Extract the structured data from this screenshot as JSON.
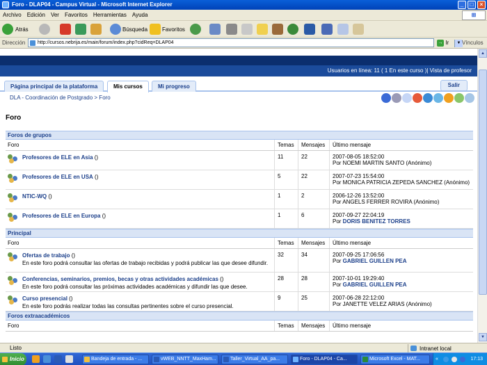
{
  "window": {
    "title": "Foro - DLAP04 - Campus Virtual - Microsoft Internet Explorer"
  },
  "menu": [
    "Archivo",
    "Edición",
    "Ver",
    "Favoritos",
    "Herramientas",
    "Ayuda"
  ],
  "toolbar": {
    "back": "Atrás",
    "search": "Búsqueda",
    "favorites": "Favoritos"
  },
  "address": {
    "label": "Dirección",
    "url": "http://cursos.nebrija.es/main/forum/index.php?cidReq=DLAP04",
    "go": "Ir",
    "links": "Vínculos"
  },
  "site": {
    "users_online": "Usuarios en línea:  11  ( 1 En este curso  )| Vista de profesor",
    "tabs": [
      "Página principal de la plataforma",
      "Mis cursos",
      "Mi progreso"
    ],
    "active_tab": "Mis cursos",
    "logout": "Salir",
    "breadcrumb": "DLA - Coordinación de Postgrado > Foro",
    "page_title": "Foro"
  },
  "columns": {
    "forum": "Foro",
    "topics": "Temas",
    "messages": "Mensajes",
    "last": "Último mensaje"
  },
  "sections": [
    {
      "title": "Foros de grupos",
      "forums": [
        {
          "name": "Profesores de ELE en Asia",
          "suffix": " ()",
          "desc": "",
          "topics": "11",
          "messages": "22",
          "date": "2007-08-05 18:52:00",
          "by": "Por NOEMI MARTIN SANTO (Anónimo)",
          "by_link": ""
        },
        {
          "name": "Profesores de ELE en USA",
          "suffix": " ()",
          "desc": "",
          "topics": "5",
          "messages": "22",
          "date": "2007-07-23 15:54:00",
          "by": "Por MONICA PATRICIA ZEPEDA SANCHEZ (Anónimo)",
          "by_link": ""
        },
        {
          "name": "NTIC-WQ",
          "suffix": " ()",
          "desc": "",
          "topics": "1",
          "messages": "2",
          "date": "2006-12-26 13:52:00",
          "by": "Por ANGELS FERRER ROVIRA (Anónimo)",
          "by_link": ""
        },
        {
          "name": "Profesores de ELE en Europa",
          "suffix": " ()",
          "desc": "",
          "topics": "1",
          "messages": "6",
          "date": "2007-09-27 22:04:19",
          "by": "Por ",
          "by_link": "DORIS BENITEZ TORRES"
        }
      ]
    },
    {
      "title": "Principal",
      "forums": [
        {
          "name": "Ofertas de trabajo",
          "suffix": " ()",
          "desc": "En este foro podrá consultar las ofertas de trabajo recibidas y podrá publicar las que desee difundir.",
          "topics": "32",
          "messages": "34",
          "date": "2007-09-25 17:06:56",
          "by": "Por ",
          "by_link": "GABRIEL GUILLEN PEA"
        },
        {
          "name": "Conferencias, seminarios, premios, becas y otras actividades académicas",
          "suffix": " ()",
          "desc": "En este foro podrá consultar las próximas actividades académicas y difundir las que desee.",
          "topics": "28",
          "messages": "28",
          "date": "2007-10-01 19:29:40",
          "by": "Por ",
          "by_link": "GABRIEL GUILLEN PEA"
        },
        {
          "name": "Curso presencial",
          "suffix": " ()",
          "desc": "En este foro podrás realizar todas las consultas pertinentes sobre el curso presencial.",
          "topics": "9",
          "messages": "25",
          "date": "2007-06-28 22:12:00",
          "by": "Por JANETTE VELEZ ARIAS (Anónimo)",
          "by_link": ""
        }
      ]
    },
    {
      "title": "Foros extraacadémicos",
      "forums": []
    }
  ],
  "status": {
    "text": "Listo",
    "zone": "Intranet local"
  },
  "taskbar": {
    "start": "Inicio",
    "tasks": [
      "Bandeja de entrada - ...",
      "vWEB_NNTT_MaxHam...",
      "Taller_Virtual_AA_pa...",
      "Foro - DLAP04 - Ca...",
      "Microsoft Excel - MAT..."
    ],
    "clock": "17:13"
  }
}
